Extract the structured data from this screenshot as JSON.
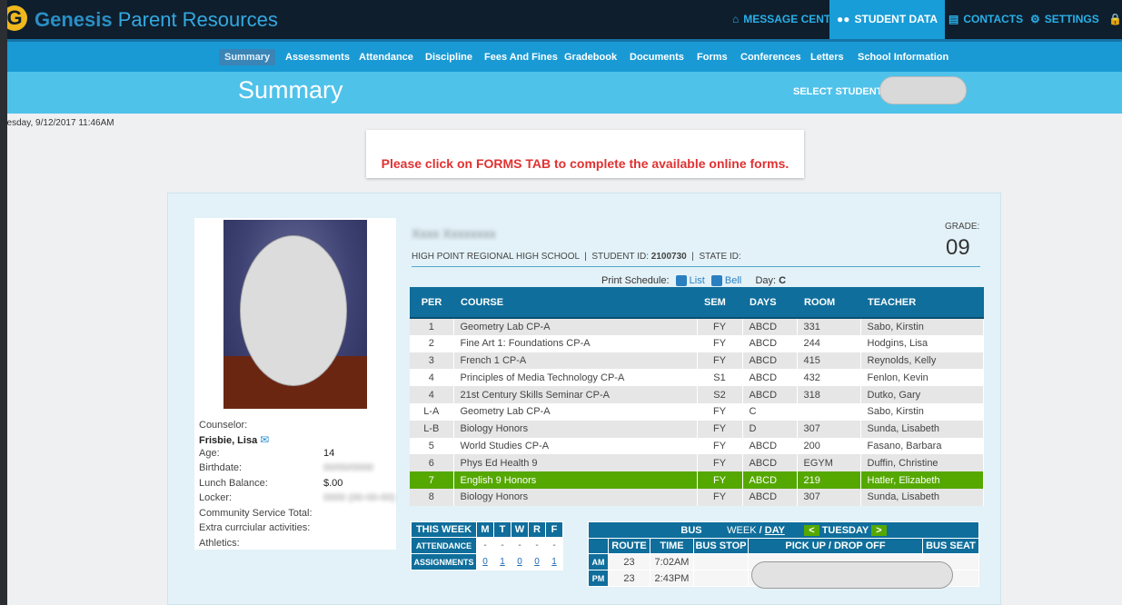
{
  "header": {
    "brand_main": "Genesis",
    "brand_sub": "Parent Resources",
    "logo_letter": "G",
    "nav": [
      {
        "label": "MESSAGE CENTER",
        "icon": "home-icon",
        "active": false
      },
      {
        "label": "STUDENT DATA",
        "icon": "users-icon",
        "active": true
      },
      {
        "label": "CONTACTS",
        "icon": "contacts-icon",
        "active": false
      },
      {
        "label": "SETTINGS",
        "icon": "gear-icon",
        "active": false
      }
    ]
  },
  "subnav": [
    "Summary",
    "Assessments",
    "Attendance",
    "Discipline",
    "Fees And Fines",
    "Gradebook",
    "Documents",
    "Forms",
    "Conferences",
    "Letters",
    "School Information"
  ],
  "page": {
    "title": "Summary",
    "select_student_label": "SELECT STUDENT",
    "date": "uesday, 9/12/2017 11:46AM",
    "notice": "Please click on FORMS TAB to complete the available online forms."
  },
  "student": {
    "school": "HIGH POINT REGIONAL HIGH SCHOOL",
    "student_id_label": "STUDENT ID:",
    "student_id": "2100730",
    "state_id_label": "STATE ID:",
    "grade_label": "GRADE:",
    "grade": "09",
    "counselor_label": "Counselor:",
    "counselor": "Frisbie, Lisa",
    "age_label": "Age:",
    "age": "14",
    "birthdate_label": "Birthdate:",
    "lunch_label": "Lunch Balance:",
    "lunch": "$.00",
    "locker_label": "Locker:",
    "community_label": "Community Service Total:",
    "extra_label": "Extra currciular activities:",
    "athletics_label": "Athletics:"
  },
  "print": {
    "label": "Print Schedule:",
    "list": "List",
    "bell": "Bell",
    "day_label": "Day:",
    "day": "C"
  },
  "schedule": {
    "headers": [
      "PER",
      "COURSE",
      "SEM",
      "DAYS",
      "ROOM",
      "TEACHER"
    ],
    "rows": [
      [
        "1",
        "Geometry Lab CP-A",
        "FY",
        "ABCD",
        "331",
        "Sabo, Kirstin"
      ],
      [
        "2",
        "Fine Art 1: Foundations CP-A",
        "FY",
        "ABCD",
        "244",
        "Hodgins, Lisa"
      ],
      [
        "3",
        "French 1 CP-A",
        "FY",
        "ABCD",
        "415",
        "Reynolds, Kelly"
      ],
      [
        "4",
        "Principles of Media Technology CP-A",
        "S1",
        "ABCD",
        "432",
        "Fenlon, Kevin"
      ],
      [
        "4",
        "21st Century Skills Seminar CP-A",
        "S2",
        "ABCD",
        "318",
        "Dutko, Gary"
      ],
      [
        "L-A",
        "Geometry Lab CP-A",
        "FY",
        "C",
        "",
        "Sabo, Kirstin"
      ],
      [
        "L-B",
        "Biology Honors",
        "FY",
        "D",
        "307",
        "Sunda, Lisabeth"
      ],
      [
        "5",
        "World Studies CP-A",
        "FY",
        "ABCD",
        "200",
        "Fasano, Barbara"
      ],
      [
        "6",
        "Phys Ed Health 9",
        "FY",
        "ABCD",
        "EGYM",
        "Duffin, Christine"
      ],
      [
        "7",
        "English 9 Honors",
        "FY",
        "ABCD",
        "219",
        "Hatler, Elizabeth"
      ],
      [
        "8",
        "Biology Honors",
        "FY",
        "ABCD",
        "307",
        "Sunda, Lisabeth"
      ]
    ],
    "highlight_index": 9
  },
  "week": {
    "title": "THIS WEEK",
    "days": [
      "M",
      "T",
      "W",
      "R",
      "F"
    ],
    "attendance_label": "ATTENDANCE",
    "attendance": [
      "-",
      "-",
      "-",
      "-",
      "-"
    ],
    "assignments_label": "ASSIGNMENTS",
    "assignments": [
      "0",
      "1",
      "0",
      "0",
      "1"
    ]
  },
  "bus": {
    "title": "BUS",
    "view_week": "WEEK",
    "view_sep": "/",
    "view_day": "DAY",
    "day": "TUESDAY",
    "prev": "<",
    "next": ">",
    "headers": [
      "ROUTE",
      "TIME",
      "BUS STOP",
      "PICK UP / DROP OFF",
      "BUS SEAT"
    ],
    "rows": [
      {
        "period": "AM",
        "route": "23",
        "time": "7:02AM"
      },
      {
        "period": "PM",
        "route": "23",
        "time": "2:43PM"
      }
    ]
  }
}
